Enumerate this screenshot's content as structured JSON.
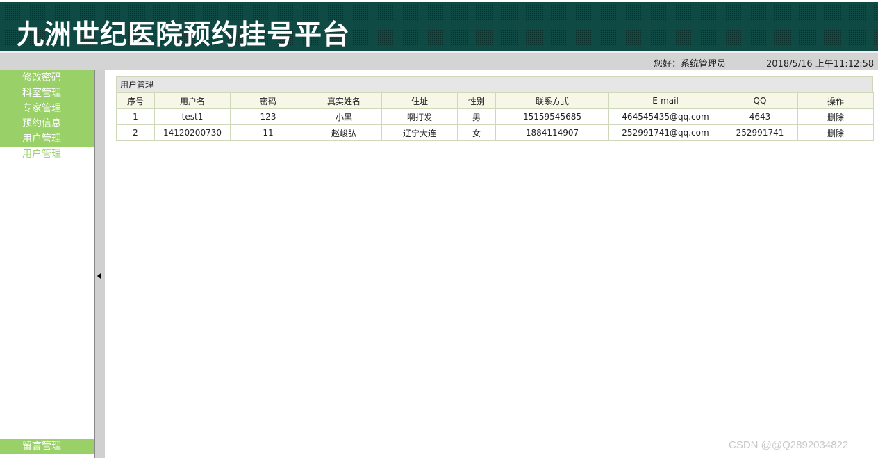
{
  "header": {
    "title": "九洲世纪医院预约挂号平台"
  },
  "status": {
    "greeting": "您好：系统管理员",
    "datetime": "2018/5/16 上午11:12:58"
  },
  "sidebar": {
    "items": [
      {
        "label": "修改密码"
      },
      {
        "label": "科室管理"
      },
      {
        "label": "专家管理"
      },
      {
        "label": "预约信息"
      },
      {
        "label": "用户管理"
      }
    ],
    "sub_item": {
      "label": "用户管理"
    },
    "bottom_item": {
      "label": "留言管理"
    }
  },
  "panel": {
    "title": "用户管理",
    "columns": [
      "序号",
      "用户名",
      "密码",
      "真实姓名",
      "住址",
      "性别",
      "联系方式",
      "E-mail",
      "QQ",
      "操作"
    ],
    "rows": [
      [
        "1",
        "test1",
        "123",
        "小黑",
        "啊打发",
        "男",
        "15159545685",
        "464545435@qq.com",
        "4643",
        "删除"
      ],
      [
        "2",
        "14120200730",
        "11",
        "赵峻弘",
        "辽宁大连",
        "女",
        "1884114907",
        "252991741@qq.com",
        "252991741",
        "删除"
      ]
    ]
  },
  "watermark": "CSDN @@Q2892034822",
  "colors": {
    "header_bg": "#0f4a44",
    "menu_green": "#99d168",
    "status_bg": "#d4d4d4",
    "table_border": "#cfd8b8"
  }
}
